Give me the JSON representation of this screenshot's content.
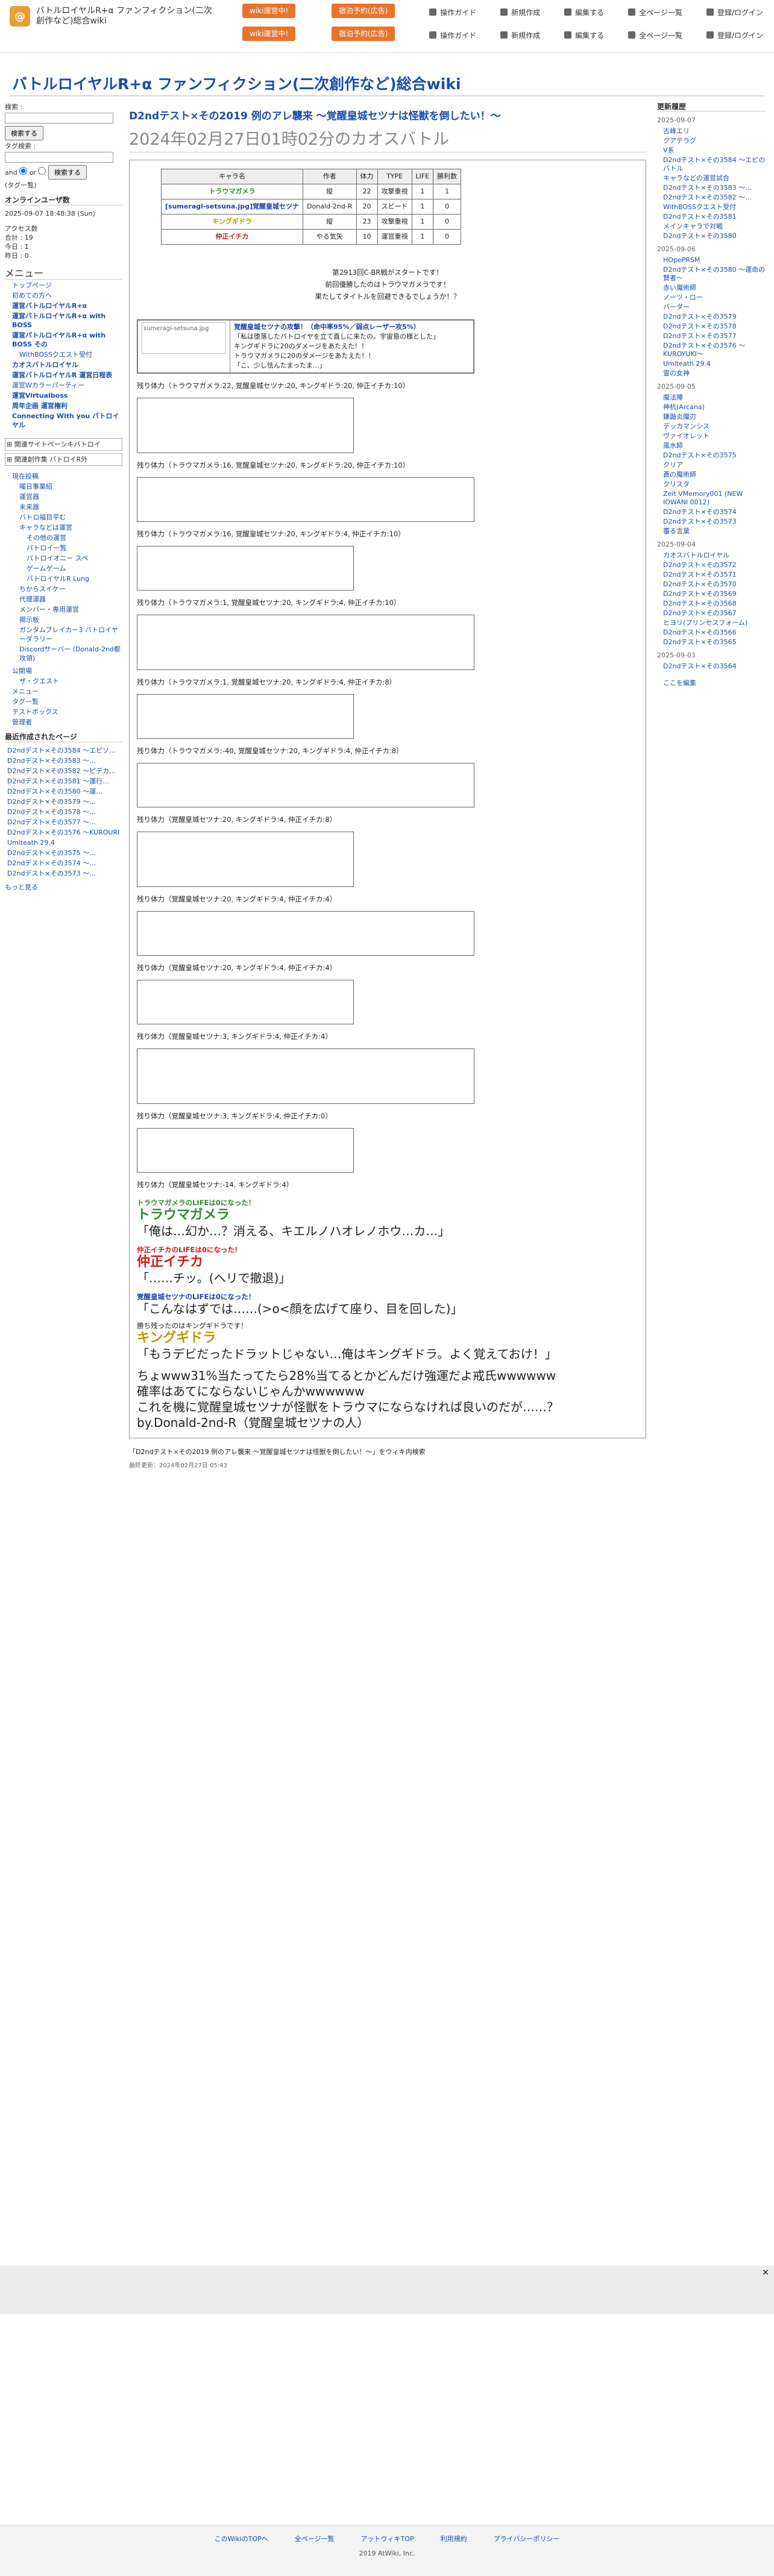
{
  "header": {
    "site_name": "バトルロイヤルR+α ファンフィクション(二次創作など)総合wiki",
    "ad1": "wiki運営中!",
    "ad2": "宿泊予約(広告)",
    "toolbar": [
      "操作ガイド",
      "新規作成",
      "編集する",
      "全ページ一覧",
      "登録/ログイン"
    ]
  },
  "site_title": "バトルロイヤルR+α ファンフィクション(二次創作など)総合wiki",
  "left": {
    "search_label": "検索 :",
    "search_button": "検索する",
    "tag_label": "タグ検索 :",
    "and_label": "and",
    "or_label": "or",
    "tag_button": "検索する",
    "tag_list_label": "(タグ一覧)",
    "online_h": "オンラインユーザ数",
    "online_lines": [
      "2025-09-07 18:48:38 (Sun)",
      "",
      "アクセス数",
      "合計 : 19",
      "今日 : 1",
      "昨日 : 0"
    ],
    "menu_h": "メニュー",
    "menu": [
      {
        "t": "トップページ",
        "b": false
      },
      {
        "t": "初めての方へ",
        "b": false
      },
      {
        "t": "運営バトルロイヤルR+α",
        "b": true
      },
      {
        "t": "運営バトルロイヤルR+α with BOSS",
        "b": true
      },
      {
        "t": "運営バトルロイヤルR+α with BOSS その",
        "b": true
      },
      {
        "t": "WithBOSSクエスト受付",
        "b": false
      },
      {
        "t": "カオスバトルロイヤル",
        "b": true
      },
      {
        "t": "運営バトルロイヤルR 運営日程表",
        "b": true
      },
      {
        "t": "運営Wカラーパーティー",
        "b": false
      },
      {
        "t": "運営Virtualboss",
        "b": true
      },
      {
        "t": "周年企画 運営権利",
        "b": true
      },
      {
        "t": "Connecting With you バトロイヤル",
        "b": true
      }
    ],
    "sections": [
      "関連サイトペーシキバトロイ",
      "関連創作集 バトロイR外"
    ],
    "tree": [
      "現在投稿",
      "曜日事業紹",
      "運営器",
      "未来器",
      "バトロ福目平む",
      "キャラなどは運営",
      "その他の運営",
      "バトロイ一覧",
      "パトロイオニー スペ",
      "ゲームゲーム",
      "バトロイヤルR Lung",
      "ちからスイケー",
      "代理運器",
      "メンバー・専用運営",
      "掲示板",
      "ガンタムブレイカー3 バトロイヤーダラリー",
      "Discordサーバー (Donald-2nd都攻領)"
    ],
    "sub": [
      "公開場",
      "ザ・クエスト",
      "メニュー",
      "タグ一覧",
      "テストボックス",
      "管理者"
    ],
    "recent_h": "最近作成されたページ",
    "recent": [
      "D2ndデスト×その3584 〜エピソ…",
      "D2ndデスト×その3583 〜…",
      "D2ndデスト×その3582 〜ピデカ…",
      "D2ndデスト×その3581 〜運行…",
      "D2ndデスト×その3580 〜運…",
      "D2ndデスト×その3579 〜…",
      "D2ndデスト×その3578 〜…",
      "D2ndデスト×その3577 〜…",
      "D2ndデスト×その3576 〜KUROURI",
      "Umiteath 29.4",
      "D2ndデスト×その3575 〜…",
      "D2ndデスト×その3574 〜…",
      "D2ndデスト×その3573 〜…"
    ],
    "more": "もっと見る"
  },
  "right": {
    "h": "更新履歴",
    "groups": [
      {
        "date": "2025-09-07",
        "items": [
          "古峰エリ",
          "クアテラグ",
          "V系",
          "D2ndテスト×その3584 〜エピのバトル",
          "キャラなどの運営試合",
          "D2ndテスト×その3583 〜…",
          "D2ndテスト×その3582 〜…",
          "WithBOSSクエスト受付",
          "D2ndテスト×その3581",
          "メインキャラで対戦",
          "D2ndテスト×その3580"
        ]
      },
      {
        "date": "2025-09-06",
        "items": [
          "HOpePRSM",
          "D2ndテスト×その3580 〜運命の賢者〜",
          "赤い魔術師",
          "ノーツ・ロー",
          "パーダー",
          "D2ndテスト×その3579",
          "D2ndテスト×その3578",
          "D2ndテスト×その3577",
          "D2ndテスト×その3576 〜KUROYUKI〜",
          "Umiteath 29.4",
          "霊の女神"
        ]
      },
      {
        "date": "2025-09-05",
        "items": [
          "魔法陣",
          "神杭(Arcana)",
          "鎌鼬炎魔刃",
          "デッカマンシス",
          "ヴァイオレット",
          "風水師",
          "D2ndテスト×その3575",
          "クリア",
          "蒼の魔術師",
          "クリスタ",
          "Zeit VMemory001 (NEW IOWANI 0012)",
          "D2ndテスト×その3574",
          "D2ndテスト×その3573",
          "覆る言葉"
        ]
      },
      {
        "date": "2025-09-04",
        "items": [
          "カオスバトルロイヤル",
          "D2ndテスト×その3572",
          "D2ndテスト×その3571",
          "D2ndテスト×その3570",
          "D2ndテスト×その3569",
          "D2ndテスト×その3568",
          "D2ndテスト×その3567",
          "ヒヨリ(プリンセスフォーム)",
          "D2ndテスト×その3566",
          "D2ndテスト×その3565"
        ]
      },
      {
        "date": "2025-09-03",
        "items": [
          "D2ndテスト×その3564"
        ]
      }
    ],
    "more": "ここを編集"
  },
  "main": {
    "title": "D2ndテスト×その2019 例のアレ襲来 〜覚醒皇城セツナは怪獣を倒したい！〜",
    "subtitle": "2024年02月27日01時02分のカオスバトル",
    "table": {
      "headers": [
        "キャラ名",
        "作者",
        "体力",
        "TYPE",
        "LIFE",
        "勝利数"
      ],
      "rows": [
        {
          "name": "トラウマガメラ",
          "color": "green",
          "author": "縦",
          "hp": "22",
          "type": "攻撃重視",
          "life": "1",
          "wins": "1"
        },
        {
          "name": "[sumeragi-setsuna.jpg]覚醒皇城セツナ",
          "color": "blue",
          "author": "Donald-2nd-R",
          "hp": "20",
          "type": "スピード",
          "life": "1",
          "wins": "0"
        },
        {
          "name": "キングギドラ",
          "color": "yellow",
          "author": "縦",
          "hp": "23",
          "type": "攻撃重視",
          "life": "1",
          "wins": "0"
        },
        {
          "name": "仲正イチカ",
          "color": "red",
          "author": "やる気矢",
          "hp": "10",
          "type": "運営重視",
          "life": "1",
          "wins": "0"
        }
      ]
    },
    "intro": [
      "第2913回C-BR戦がスタートです！",
      "前回優勝したのはトラウマガメラです！",
      "果たしてタイトルを回避できるでしょうか！？"
    ],
    "blocks": [
      "覚醒皇城セツナの攻撃！（命中率95%／弱点レーザー攻5%）",
      "「私は堕落したバトロイヤを立て直しに来たの。宇宙島の様とした」",
      "キングギドラに20のダメージをあたえた！！",
      "トラウマガメラに20のダメージをあたえた！！",
      "「こ、少し怯んたまったま…」",
      "残り体力（トラウマガメラ:22, 覚醒皇城セツナ:20, キングギドラ:20, 仲正イチカ:10）"
    ],
    "remains": [
      "残り体力（トラウマガメラ:22, 覚醒皇城セツナ:20, キングギドラ:20, 仲正イチカ:10）",
      "残り体力（トラウマガメラ:16, 覚醒皇城セツナ:20, キングギドラ:20, 仲正イチカ:10）",
      "残り体力（トラウマガメラ:16, 覚醒皇城セツナ:20, キングギドラ:4, 仲正イチカ:10）",
      "残り体力（トラウマガメラ:1, 覚醒皇城セツナ:20, キングギドラ:4, 仲正イチカ:10）",
      "残り体力（トラウマガメラ:1, 覚醒皇城セツナ:20, キングギドラ:4, 仲正イチカ:8）",
      "残り体力（トラウマガメラ:-40, 覚醒皇城セツナ:20, キングギドラ:4, 仲正イチカ:8）",
      "残り体力（覚醒皇城セツナ:20, キングギドラ:4, 仲正イチカ:8）",
      "残り体力（覚醒皇城セツナ:20, キングギドラ:4, 仲正イチカ:4）",
      "残り体力（覚醒皇城セツナ:20, キングギドラ:4, 仲正イチカ:4）",
      "残り体力（覚醒皇城セツナ:3, キングギドラ:4, 仲正イチカ:4）",
      "残り体力（覚醒皇城セツナ:3, キングギドラ:4, 仲正イチカ:0）",
      "残り体力（覚醒皇城セツナ:-14, キングギドラ:4）"
    ],
    "ending": [
      "トラウマガメラのLIFEは0になった！",
      "トラウマガメラ",
      "「俺は…幻か…？消える、キエルノハオレノホウ…カ…」",
      "仲正イチカのLIFEは0になった！",
      "仲正イチカ",
      "「……チッ。(ヘリで撤退)」",
      "覚醒皇城セツナのLIFEは0になった！",
      "「こんなはずでは……(>o<顔を広げて座り、目を回した)」",
      "勝ち残ったのはキングギドラです！",
      "キングギドラ",
      "「もうデビだったドラットじゃない…俺はキングギドラ。よく覚えておけ！」",
      "ちょwww31%当たってたら28%当てるとかどんだけ強運だよ戒氏wwwwww",
      "確率はあてにならないじゃんかwwwwww",
      "これを機に覚醒皇城セツナが怪獣をトラウマにならなければ良いのだが……？",
      "by.Donald-2nd-R（覚醒皇城セツナの人）"
    ],
    "bottom_link": "「D2ndテスト×その2019 例のアレ襲来 〜覚醒皇城セツナは怪獣を倒したい！〜」をウィキ内検索",
    "updated": "最終更新：2024年02月27日 05:43"
  },
  "footer": {
    "links": [
      "このWikiのTOPへ",
      "全ページ一覧",
      "アットウィキTOP",
      "利用規約",
      "プライバシーポリシー"
    ],
    "copy": "2019 AtWiki, Inc."
  },
  "colors": {
    "link": "#1a4fa8",
    "green": "#2e8b2e",
    "blue": "#1d3fa8",
    "yellow": "#b59b00",
    "red": "#d01818",
    "accent": "#e8742c"
  }
}
